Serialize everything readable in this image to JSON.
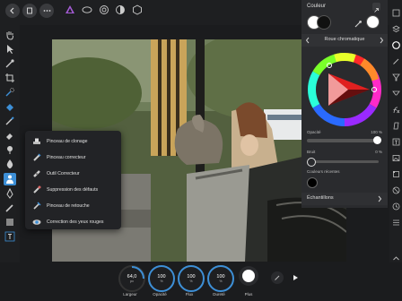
{
  "colors": {
    "accent": "#3d8fd6",
    "panel": "#2a2b2e",
    "toolbar": "#1e1f21"
  },
  "popup": {
    "items": [
      {
        "label": "Pinceau de clonage",
        "icon": "clone-brush-icon"
      },
      {
        "label": "Pinceau correcteur",
        "icon": "healing-brush-icon"
      },
      {
        "label": "Outil Correcteur",
        "icon": "patch-tool-icon"
      },
      {
        "label": "Suppression des défauts",
        "icon": "blemish-removal-icon"
      },
      {
        "label": "Pinceau de retouche",
        "icon": "inpainting-brush-icon"
      },
      {
        "label": "Correction des yeux rouges",
        "icon": "red-eye-icon"
      }
    ]
  },
  "color_panel": {
    "title": "Couleur",
    "mode": "Roue chromatique",
    "opacity_label": "Opacité",
    "opacity_value": "100 %",
    "noise_label": "Bruit",
    "noise_value": "0 %",
    "recent_label": "Couleurs récentes",
    "swatches_label": "Échantillons"
  },
  "bottom": {
    "dials": [
      {
        "value": "64,0",
        "unit": "px",
        "label": "Largeur"
      },
      {
        "value": "100",
        "unit": "%",
        "label": "Opacité"
      },
      {
        "value": "100",
        "unit": "%",
        "label": "Flux"
      },
      {
        "value": "100",
        "unit": "%",
        "label": "Dureté"
      }
    ],
    "more_label": "Plus"
  }
}
